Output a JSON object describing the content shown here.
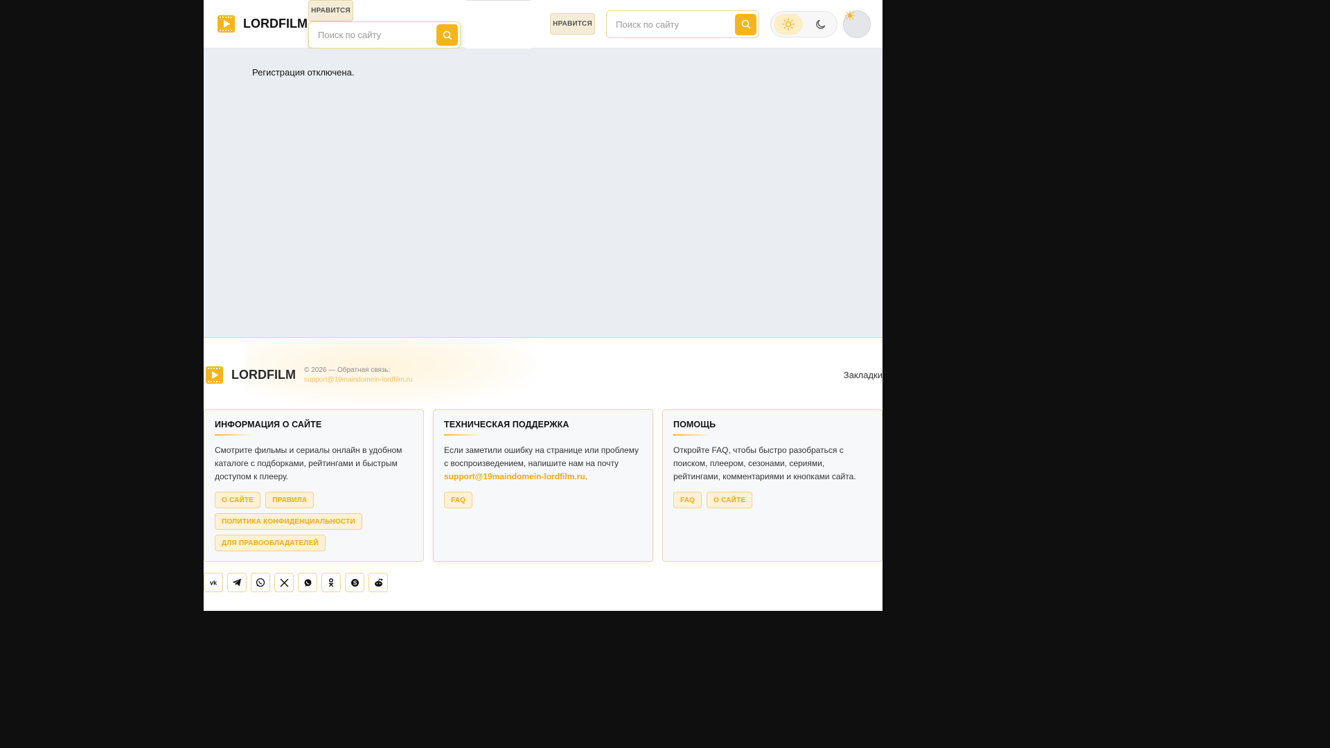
{
  "header": {
    "logo_text": "LORDFILM",
    "like_label": "НРАВИТСЯ",
    "search_placeholder": "Поиск по сайту",
    "dropdown": {
      "like_label": "НРАВИТСЯ",
      "search_placeholder": "Поиск по сайту"
    }
  },
  "main": {
    "message": "Регистрация отключена."
  },
  "footer": {
    "logo_text": "LORDFILM",
    "copyright": "© 2026 — Обратная связь:",
    "email": "support@19maindomein-lordfilm.ru",
    "bookmarks_label": "Закладки",
    "cards": [
      {
        "title": "ИНФОРМАЦИЯ О САЙТЕ",
        "text": "Смотрите фильмы и сериалы онлайн в удобном каталоге с подборками, рейтингами и быстрым доступом к плееру.",
        "tags": [
          "О САЙТЕ",
          "ПРАВИЛА",
          "ПОЛИТИКА КОНФИДЕНЦИАЛЬНОСТИ",
          "ДЛЯ ПРАВООБЛАДАТЕЛЕЙ"
        ]
      },
      {
        "title": "ТЕХНИЧЕСКАЯ ПОДДЕРЖКА",
        "text": "Если заметили ошибку на странице или проблему с воспроизведением, напишите нам на почту",
        "link": "support@19maindomein-lordfilm.ru",
        "after_link": ".",
        "tags": [
          "FAQ"
        ]
      },
      {
        "title": "ПОМОЩЬ",
        "text": "Откройте FAQ, чтобы быстро разобраться с поиском, плеером, сезонами, сериями, рейтингами, комментариями и кнопками сайта.",
        "tags": [
          "FAQ",
          "О САЙТЕ"
        ]
      }
    ],
    "socials": [
      "vk-icon",
      "telegram-icon",
      "whatsapp-icon",
      "x-icon",
      "viber-icon",
      "odnoklassniki-icon",
      "skype-icon",
      "reddit-icon"
    ]
  },
  "colors": {
    "accent": "#f6b41c",
    "link": "#f2a90e",
    "main_bg": "#eaedf1"
  }
}
